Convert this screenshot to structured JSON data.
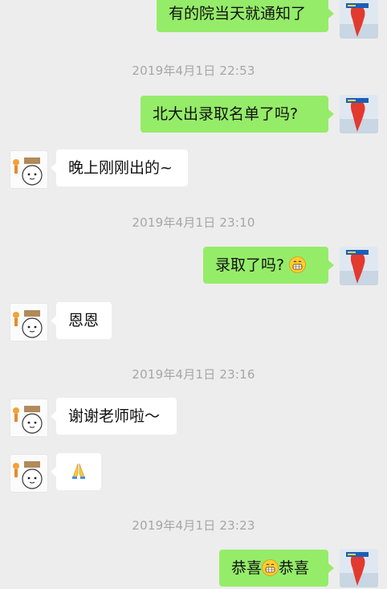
{
  "messages": [
    {
      "type": "out",
      "text": "有的院当天就通知了"
    },
    {
      "type": "time",
      "text": "2019年4月1日 22:53"
    },
    {
      "type": "out",
      "text": "北大出录取名单了吗?"
    },
    {
      "type": "in",
      "text": "晚上刚刚出的~"
    },
    {
      "type": "time",
      "text": "2019年4月1日 23:10"
    },
    {
      "type": "out",
      "text_before": "录取了吗?",
      "emoji": "grinning-face-emoji"
    },
    {
      "type": "in",
      "text": "恩恩"
    },
    {
      "type": "time",
      "text": "2019年4月1日 23:16"
    },
    {
      "type": "in",
      "text": "谢谢老师啦～"
    },
    {
      "type": "in",
      "emoji": "folded-hands-emoji"
    },
    {
      "type": "time",
      "text": "2019年4月1日 23:23"
    },
    {
      "type": "out",
      "text_before": "恭喜",
      "emoji": "grinning-face-emoji",
      "text_after": "恭喜"
    }
  ],
  "avatars": {
    "self": "teacher-avatar",
    "other": "student-avatar"
  },
  "colors": {
    "background": "#ededed",
    "outgoing_bubble": "#95ec69",
    "incoming_bubble": "#ffffff",
    "timestamp": "#a6a6a6"
  }
}
